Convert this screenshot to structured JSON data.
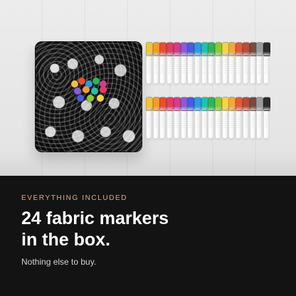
{
  "text": {
    "eyebrow": "EVERYTHING INCLUDED",
    "headline": [
      "24 fabric markers",
      "in the box."
    ],
    "subline": "Nothing else to buy."
  },
  "colors": {
    "page_background": "#121212",
    "accent": "#e6a784",
    "headline": "#ffffff",
    "subline": "#d2d2d2",
    "wood_background": "#e6e6e6",
    "bag_base": "#111111"
  },
  "markers": {
    "top_caps": [
      "#f0c43b",
      "#f39a2e",
      "#e84f2e",
      "#e23d64",
      "#d43b8d",
      "#8a5bd9",
      "#4a5be0",
      "#2a9be3",
      "#22c0b0",
      "#2fb35a",
      "#8acb2f",
      "#f6d34a",
      "#f2a73b",
      "#e35b3a",
      "#b84c3b",
      "#7b4b3a",
      "#9b9b9b",
      "#2c2c2c"
    ],
    "bottom_caps": [
      "#f2c23c",
      "#f39a2e",
      "#e84f2e",
      "#e23d64",
      "#d43b8d",
      "#8a5bd9",
      "#4a5be0",
      "#2a9be3",
      "#22c0b0",
      "#2fb35a",
      "#8acb2f",
      "#f6d34a",
      "#f2a73b",
      "#e35b3a",
      "#b84c3b",
      "#7b4b3a",
      "#9b9b9b",
      "#2c2c2c"
    ]
  },
  "bag": {
    "dot_colors": [
      "#f2c23c",
      "#e84f2e",
      "#2a9be3",
      "#2fb35a",
      "#d43b8d",
      "#8a5bd9",
      "#f39a2e",
      "#22c0b0",
      "#e23d64",
      "#4a5be0",
      "#8acb2f",
      "#f6d34a"
    ]
  }
}
